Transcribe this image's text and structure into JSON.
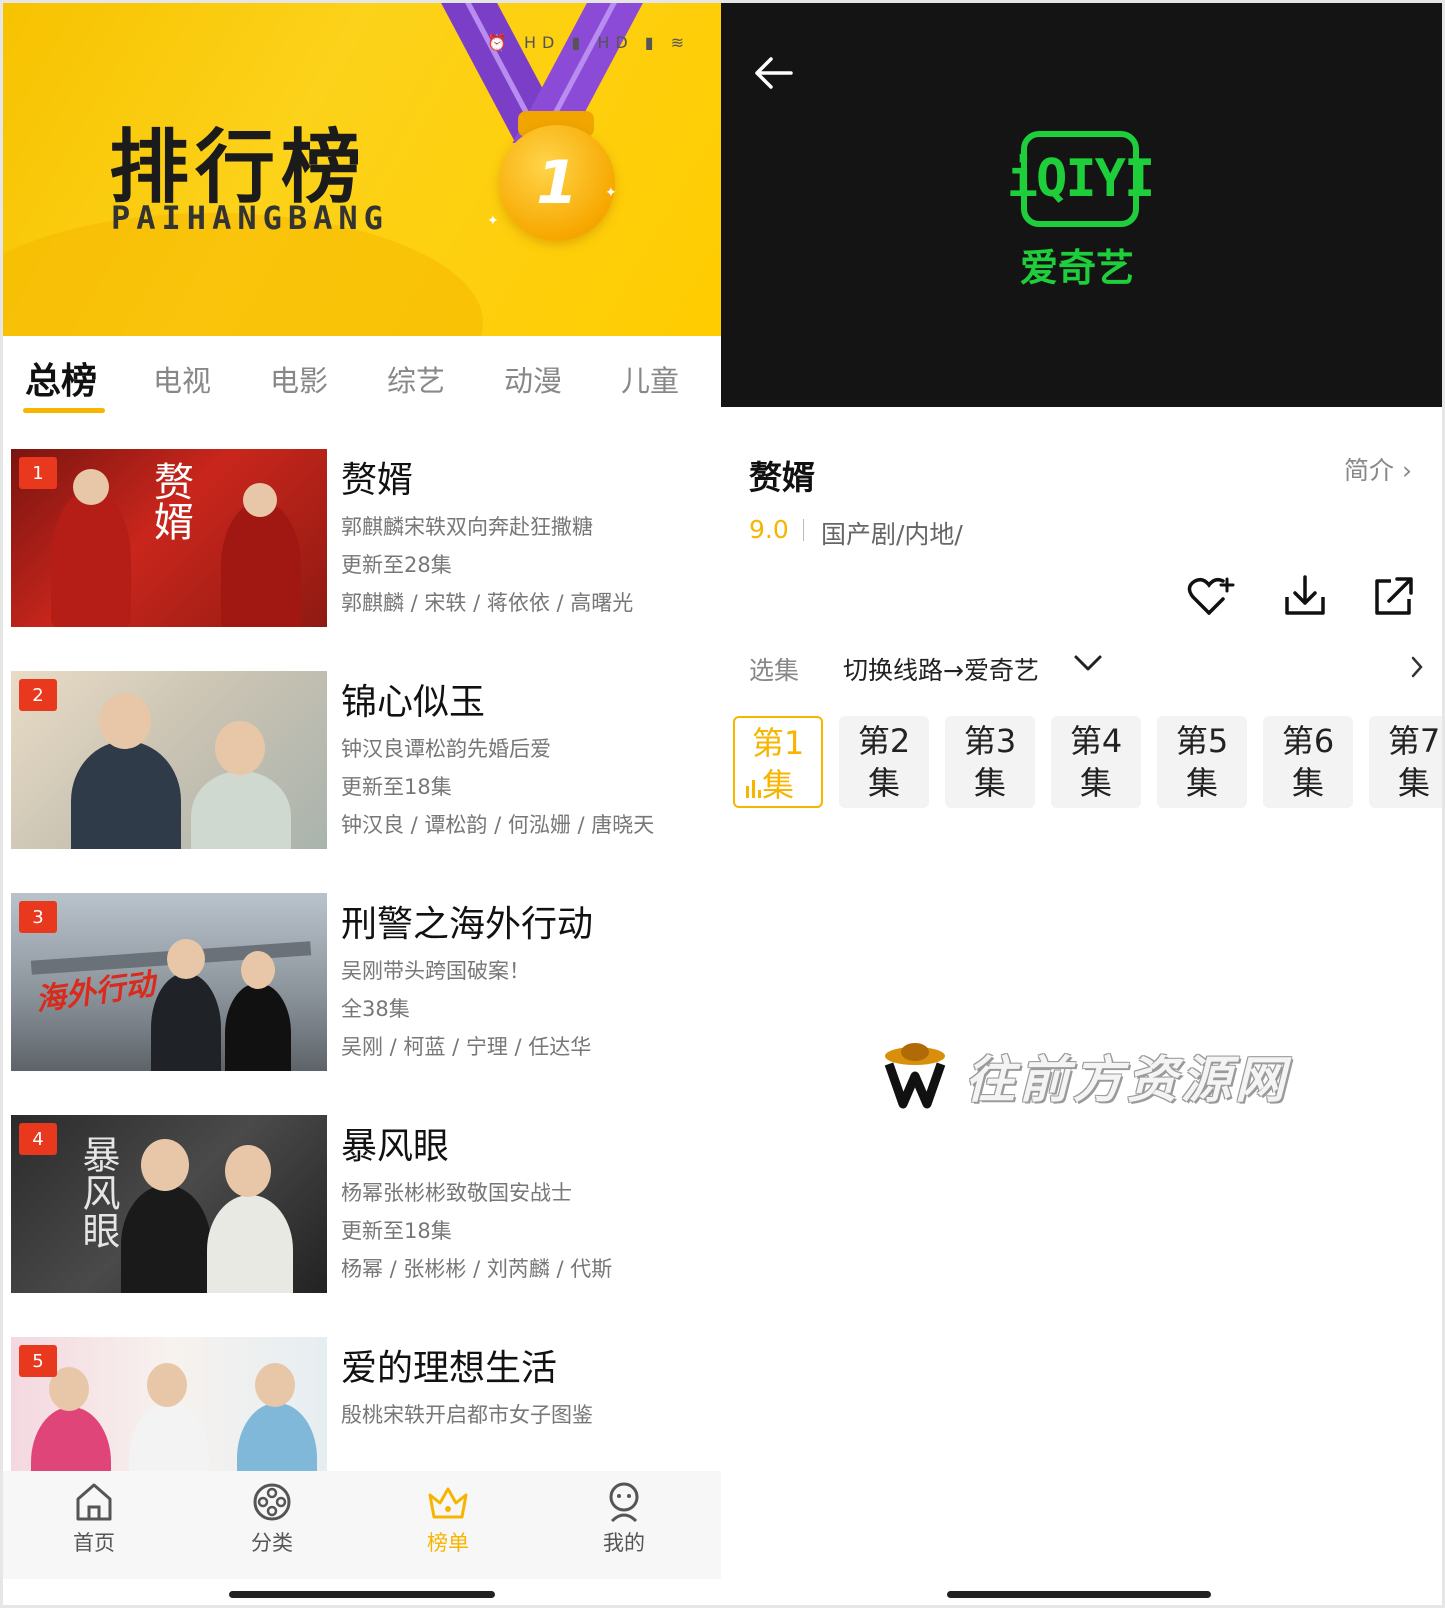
{
  "left": {
    "banner": {
      "title": "排行榜",
      "subtitle": "PAIHANGBANG",
      "medal_number": "1",
      "status_text": "⏰ HD ▮ HD ▮ ≋"
    },
    "tabs": [
      {
        "label": "总榜"
      },
      {
        "label": "电视"
      },
      {
        "label": "电影"
      },
      {
        "label": "综艺"
      },
      {
        "label": "动漫"
      },
      {
        "label": "儿童"
      }
    ],
    "items": [
      {
        "rank": "1",
        "title": "赘婿",
        "desc": "郭麒麟宋轶双向奔赴狂撒糖",
        "update": "更新至28集",
        "cast": "郭麒麟 / 宋轶 / 蒋依依 / 高曙光",
        "poster_text": "赘婿"
      },
      {
        "rank": "2",
        "title": "锦心似玉",
        "desc": "钟汉良谭松韵先婚后爱",
        "update": "更新至18集",
        "cast": "钟汉良 / 谭松韵 / 何泓姗 / 唐晓天",
        "poster_text": ""
      },
      {
        "rank": "3",
        "title": "刑警之海外行动",
        "desc": "吴刚带头跨国破案！",
        "update": "全38集",
        "cast": "吴刚 / 柯蓝 / 宁理 / 任达华",
        "poster_text": "海外行动"
      },
      {
        "rank": "4",
        "title": "暴风眼",
        "desc": "杨幂张彬彬致敬国安战士",
        "update": "更新至18集",
        "cast": "杨幂 / 张彬彬 / 刘芮麟 / 代斯",
        "poster_text": "暴风眼"
      },
      {
        "rank": "5",
        "title": "爱的理想生活",
        "desc": "殷桃宋轶开启都市女子图鉴",
        "update": "",
        "cast": "",
        "poster_text": ""
      }
    ],
    "nav": [
      {
        "label": "首页",
        "icon": "home-icon"
      },
      {
        "label": "分类",
        "icon": "film-reel-icon"
      },
      {
        "label": "榜单",
        "icon": "crown-icon"
      },
      {
        "label": "我的",
        "icon": "profile-icon"
      }
    ]
  },
  "right": {
    "player": {
      "logo_text": "iQIYI",
      "logo_cn": "爱奇艺"
    },
    "video": {
      "title": "赘婿",
      "intro_label": "简介",
      "score": "9.0",
      "genre": "国产剧/内地/"
    },
    "selector": {
      "label": "选集",
      "route": "切换线路→爱奇艺"
    },
    "episodes": [
      {
        "line1": "第1",
        "line2": "集"
      },
      {
        "line1": "第2",
        "line2": "集"
      },
      {
        "line1": "第3",
        "line2": "集"
      },
      {
        "line1": "第4",
        "line2": "集"
      },
      {
        "line1": "第5",
        "line2": "集"
      },
      {
        "line1": "第6",
        "line2": "集"
      },
      {
        "line1": "第7",
        "line2": "集"
      }
    ],
    "watermark": "往前方资源网"
  },
  "colors": {
    "accent": "#f7b500",
    "rank_badge": "#e8391f",
    "iqiyi_green": "#1ece3a"
  }
}
